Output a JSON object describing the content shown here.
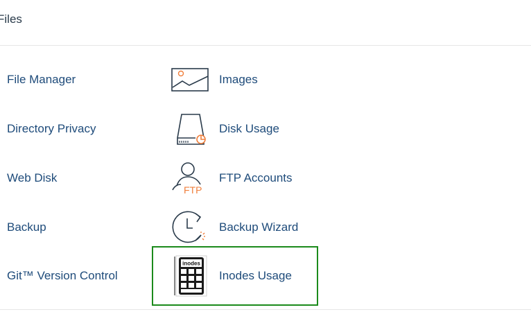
{
  "section": {
    "title": "Files"
  },
  "left_column": [
    {
      "label": "File Manager"
    },
    {
      "label": "Directory Privacy"
    },
    {
      "label": "Web Disk"
    },
    {
      "label": "Backup"
    },
    {
      "label": "Git™ Version Control"
    }
  ],
  "right_column": [
    {
      "label": "Images",
      "icon": "image-icon"
    },
    {
      "label": "Disk Usage",
      "icon": "disk-usage-icon"
    },
    {
      "label": "FTP Accounts",
      "icon": "ftp-accounts-icon",
      "icon_text": "FTP"
    },
    {
      "label": "Backup Wizard",
      "icon": "backup-wizard-icon"
    },
    {
      "label": "Inodes Usage",
      "icon": "inodes-calculator-icon",
      "icon_text": "inodes"
    }
  ],
  "colors": {
    "link": "#1e4b7a",
    "icon_stroke": "#293a4a",
    "icon_accent": "#f07f3c",
    "highlight_border": "#1b8a1b"
  }
}
